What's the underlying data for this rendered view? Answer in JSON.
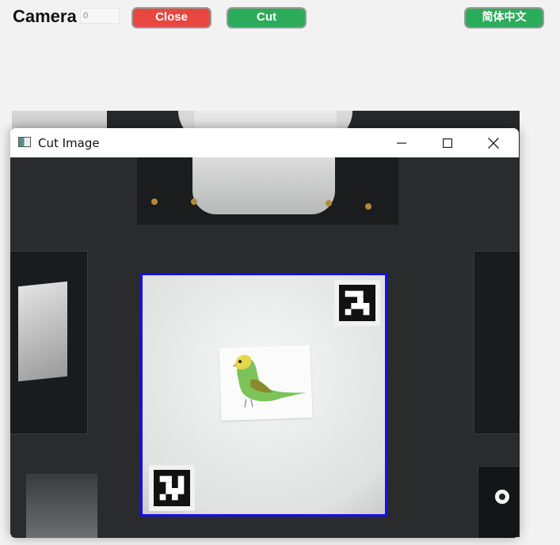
{
  "app": {
    "title": "Camera",
    "camera_index_value": "0"
  },
  "toolbar": {
    "close_label": "Close",
    "cut_label": "Cut",
    "language_label": "简体中文"
  },
  "colors": {
    "close_button": "#e8473f",
    "cut_button": "#2cac5a",
    "language_button": "#2cac5a",
    "selection_border": "#1510e6"
  },
  "window": {
    "title": "Cut Image",
    "icons": {
      "app": "image-window-icon",
      "minimize": "minimize-icon",
      "maximize": "maximize-icon",
      "close": "close-icon"
    }
  },
  "content": {
    "markers": [
      "aruco-marker-top-right",
      "aruco-marker-bottom-left"
    ],
    "picture": "budgerigar-card"
  }
}
